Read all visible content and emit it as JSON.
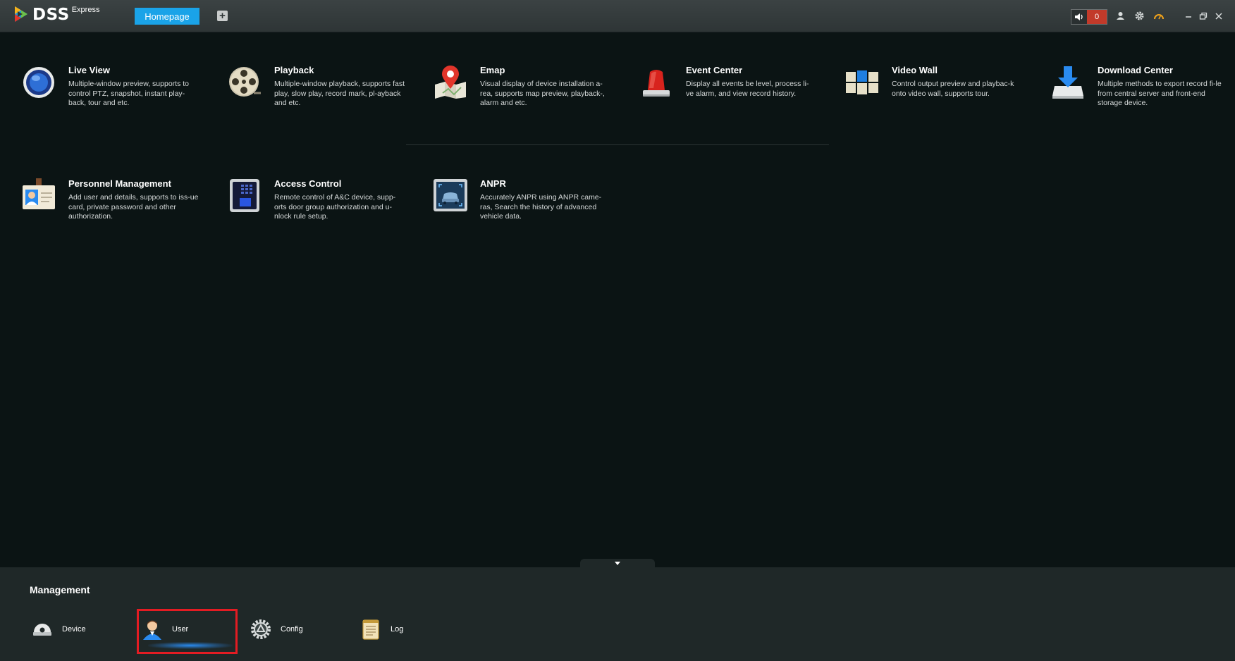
{
  "app": {
    "logo": "DSS",
    "logo_sub": "Express"
  },
  "tabs": {
    "active": "Homepage"
  },
  "topbar": {
    "alarm_count": "0"
  },
  "modules": [
    {
      "title": "Live View",
      "desc": "Multiple-window preview, supports to control PTZ, snapshot, instant play-back, tour and etc."
    },
    {
      "title": "Playback",
      "desc": "Multiple-window playback, supports fast play, slow play, record mark, pl-ayback and etc."
    },
    {
      "title": "Emap",
      "desc": "Visual display of device installation a-rea, supports map preview, playback-, alarm and etc."
    },
    {
      "title": "Event Center",
      "desc": "Display all events be level, process li-ve alarm, and view record history."
    },
    {
      "title": "Video Wall",
      "desc": "Control output preview and playbac-k onto video wall, supports tour."
    },
    {
      "title": "Download Center",
      "desc": "Multiple methods to export record fi-le from central server and front-end storage device."
    },
    {
      "title": "Personnel Management",
      "desc": "Add user and details, supports to iss-ue card, private password and other authorization."
    },
    {
      "title": "Access Control",
      "desc": "Remote control of A&C device, supp-orts door group authorization and u-nlock rule setup."
    },
    {
      "title": "ANPR",
      "desc": "Accurately ANPR using ANPR came-ras, Search the history of advanced vehicle data."
    }
  ],
  "management": {
    "title": "Management",
    "items": [
      {
        "label": "Device"
      },
      {
        "label": "User"
      },
      {
        "label": "Config"
      },
      {
        "label": "Log"
      }
    ]
  }
}
